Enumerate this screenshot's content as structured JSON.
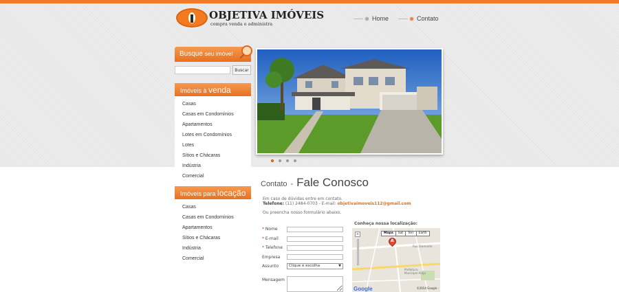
{
  "brand": {
    "name": "OBJETIVA IMÓVEIS",
    "tagline": "compra venda e administra",
    "accent_color": "#f07a2a"
  },
  "nav": {
    "items": [
      {
        "label": "Home",
        "icon": "bullet-gray"
      },
      {
        "label": "Contato",
        "icon": "bullet-orange"
      }
    ]
  },
  "search": {
    "title_a": "Busque",
    "title_b": "seu imóvel",
    "placeholder": "",
    "button_label": "Buscar"
  },
  "venda": {
    "title_a": "Imóveis à",
    "title_b": "venda",
    "items": [
      "Casas",
      "Casas em Condomínios",
      "Apartamentos",
      "Lotes em Condomínios",
      "Lotes",
      "Sítios e Chácaras",
      "Indústria",
      "Comercial"
    ]
  },
  "locacao": {
    "title_a": "Imóveis para",
    "title_b": "locação",
    "items": [
      "Casas",
      "Casas em Condomínios",
      "Apartamentos",
      "Sítios e Chácaras",
      "Indústria",
      "Comercial"
    ]
  },
  "slider": {
    "slide_count": 4,
    "active_index": 0
  },
  "contact": {
    "title_pre": "Contato",
    "title_sep": "-",
    "title_main": "Fale Conosco",
    "intro_line": "Em caso de dúvidas entre em contato.",
    "phone_label": "Telefone:",
    "phone_value": "(11) 2484-0703 - E-mail:",
    "email": "objetivaimoveis112@gmail.com",
    "form_intro": "Ou preencha nosso formulário abaixo.",
    "fields": {
      "nome": "Nome",
      "email": "E-mail",
      "telefone": "Telefone",
      "empresa": "Empresa",
      "assunto": "Assunto",
      "mensagem": "Mensagem",
      "required_mark": "*"
    },
    "assunto_selected": "Clique e escolha"
  },
  "map": {
    "title": "Conheça nossa localização:",
    "tabs": [
      "Mapa",
      "Sat",
      "Terr",
      "Earth"
    ],
    "active_tab": "Mapa",
    "marker_label": "A",
    "zoom_in": "+",
    "place_label": "Prefeitura Municipal Arujá",
    "road_label": "Rua Diamante",
    "copyright": "©2014 Google -",
    "google_logo": "Google"
  }
}
